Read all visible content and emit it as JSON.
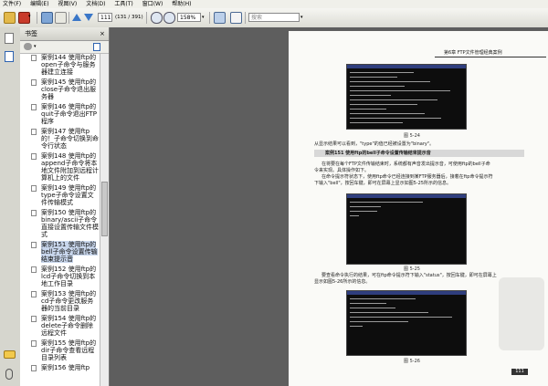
{
  "menu": [
    "文件(F)",
    "编辑(E)",
    "视图(V)",
    "文档(D)",
    "工具(T)",
    "窗口(W)",
    "帮助(H)"
  ],
  "toolbar": {
    "page_value": "111",
    "page_total": "(131 / 391)",
    "zoom_value": "158%",
    "search_placeholder": "搜索"
  },
  "panel": {
    "title": "书签",
    "close": "×"
  },
  "bookmarks": [
    "案例144 使用ftp的open子命令与服务器建立连接",
    "案例145 使用ftp的close子命令退出服务器",
    "案例146 使用ftp的quit子命令退出FTP程序",
    "案例147 使用ftp的！子命令切换到命令行状态",
    "案例148 使用ftp的append子命令将本地文件附加到远程计算机上的文件",
    "案例149 使用ftp的type子命令设置文件传输模式",
    "案例150 使用ftp的binary/ascii子命令直接设置传输文件模式",
    "案例151 使用ftp的bell子命令设置传输结束提示音",
    "案例152 使用ftp的lcd子命令切换到本地工作目录",
    "案例153 使用ftp的cd子命令更改服务器的当前目录",
    "案例154 使用ftp的delete子命令删除远程文件",
    "案例155 使用ftp的dir子命令查看远程目录列表",
    "案例156 使用ftp"
  ],
  "selected_bookmark": 7,
  "page": {
    "header": "第6章 FTP文件管理经典案例",
    "fig1": "图 5-24",
    "p1": "从显示结果可以看到，\"type\"的值已经被设置为\"binary\"。",
    "section": "案例151  使用ftp的bell子命令设置传输结束提示音",
    "p2a": "在将要在每个FTP文件传输结束时，系统都有声音发出提示音，可使用ftp的bell子命",
    "p2b": "令来实现。具体操作如下。",
    "p3a": "在命令提示符状态下，使用ftp命令已经连接到某FTP服务器后，接着在ftp命令提示符",
    "p3b": "下输入\"bell\"，按回车键，即可在屏幕上显示如图5-25所示的信息。",
    "fig2": "图 5-25",
    "p4a": "要查看命令执行的结果，可在ftp命令提示符下输入\"status\"，按回车键，即可在屏幕上",
    "p4b": "显示如图5-26所示的信息。",
    "fig3": "图 5-26",
    "page_num": "111"
  },
  "colors": {
    "selection": "#c8d6ec",
    "console_bg": "#0d0d0d",
    "console_title": "#2f3e7e"
  }
}
